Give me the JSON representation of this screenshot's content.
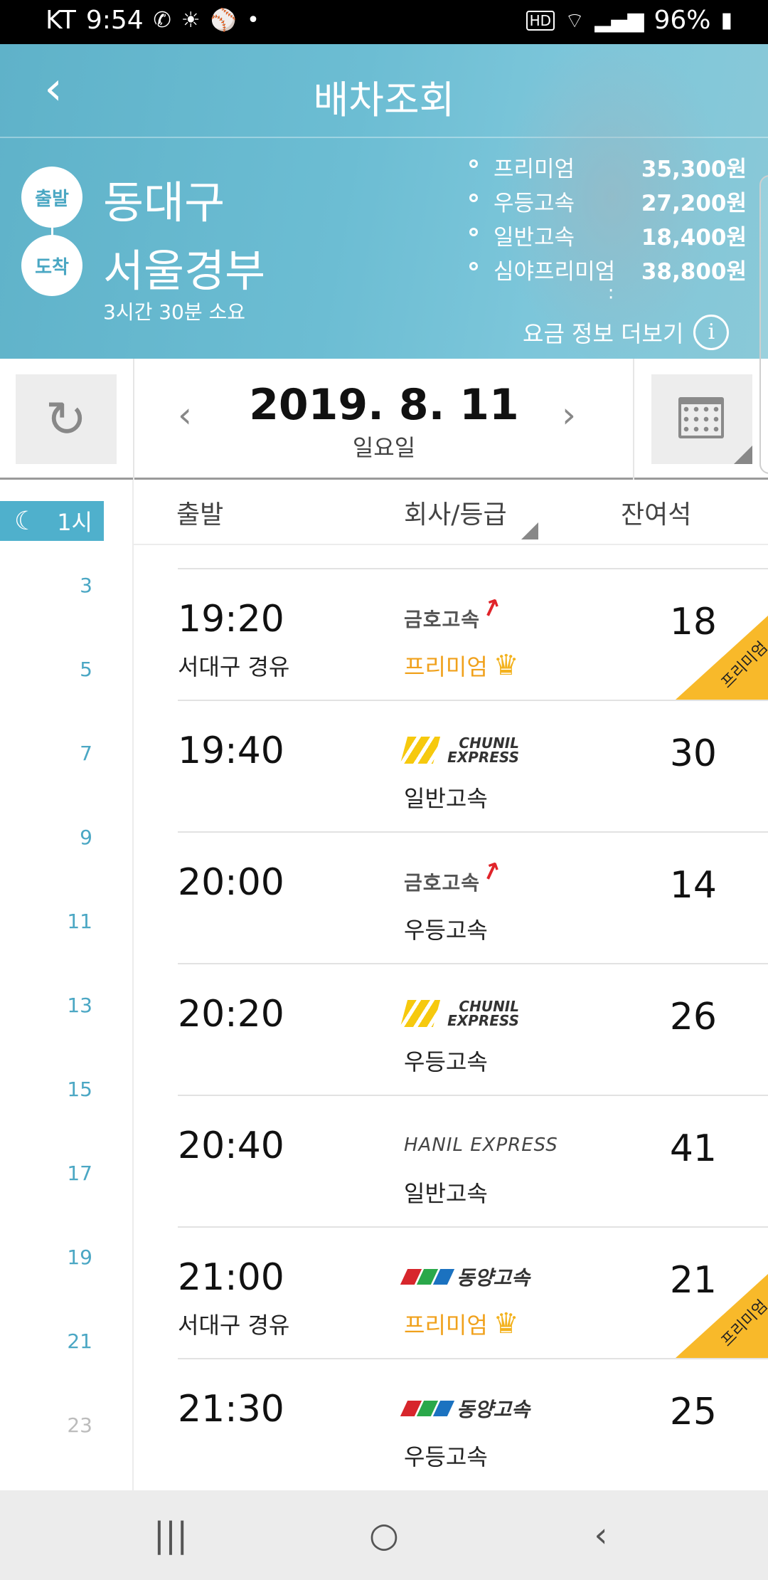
{
  "status_bar": {
    "carrier": "KT",
    "time": "9:54",
    "battery": "96%",
    "left_icons": [
      "volte-icon",
      "weather-icon",
      "baseball-icon",
      "dot-icon"
    ],
    "right_icons": [
      "hd-icon",
      "wifi-icon",
      "signal-icon",
      "battery-icon"
    ]
  },
  "header": {
    "title": "배차조회",
    "back_icon": "back-arrow-icon"
  },
  "route": {
    "departure_badge": "출발",
    "departure": "동대구",
    "arrival_badge": "도착",
    "arrival": "서울경부",
    "duration": "3시간 30분 소요"
  },
  "fares": [
    {
      "name": "프리미엄",
      "price": "35,300원"
    },
    {
      "name": "우등고속",
      "price": "27,200원"
    },
    {
      "name": "일반고속",
      "price": "18,400원"
    },
    {
      "name": "심야프리미엄",
      "price": "38,800원"
    }
  ],
  "fare_more": {
    "label": "요금 정보 더보기",
    "icon": "i"
  },
  "date_bar": {
    "date": "2019. 8. 11",
    "weekday": "일요일",
    "prev": "‹",
    "next": "›"
  },
  "sidebar": {
    "hour_label": "1시",
    "ticks": [
      "3",
      "5",
      "7",
      "9",
      "11",
      "13",
      "15",
      "17",
      "19",
      "21",
      "23"
    ]
  },
  "columns": {
    "departure": "출발",
    "company": "회사/등급",
    "seats": "잔여석"
  },
  "schedules": [
    {
      "time": "19:20",
      "via": "서대구 경유",
      "company": "금호고속",
      "company_logo": "kumho",
      "grade": "프리미엄",
      "premium": true,
      "seats": "18",
      "ribbon": "프리미엄"
    },
    {
      "time": "19:40",
      "via": "",
      "company": "CHUNIL EXPRESS",
      "company_logo": "chunil",
      "grade": "일반고속",
      "premium": false,
      "seats": "30",
      "ribbon": ""
    },
    {
      "time": "20:00",
      "via": "",
      "company": "금호고속",
      "company_logo": "kumho",
      "grade": "우등고속",
      "premium": false,
      "seats": "14",
      "ribbon": ""
    },
    {
      "time": "20:20",
      "via": "",
      "company": "CHUNIL EXPRESS",
      "company_logo": "chunil",
      "grade": "우등고속",
      "premium": false,
      "seats": "26",
      "ribbon": ""
    },
    {
      "time": "20:40",
      "via": "",
      "company": "HANIL EXPRESS",
      "company_logo": "hanil",
      "grade": "일반고속",
      "premium": false,
      "seats": "41",
      "ribbon": ""
    },
    {
      "time": "21:00",
      "via": "서대구 경유",
      "company": "동양고속",
      "company_logo": "dongyang",
      "grade": "프리미엄",
      "premium": true,
      "seats": "21",
      "ribbon": "프리미엄"
    },
    {
      "time": "21:30",
      "via": "",
      "company": "동양고속",
      "company_logo": "dongyang",
      "grade": "우등고속",
      "premium": false,
      "seats": "25",
      "ribbon": ""
    }
  ],
  "colors": {
    "accent": "#4fb0cc",
    "premium": "#f0a11c",
    "ribbon": "#f8b92a",
    "kumho_red": "#e0242a",
    "chunil_yellow": "#f6c90e",
    "dongyang_red": "#d7262c",
    "dongyang_green": "#2aa84a",
    "dongyang_blue": "#1b72c0"
  },
  "nav_bar": {
    "recent_icon": "|||",
    "home_icon": "○",
    "back_icon": "‹"
  }
}
